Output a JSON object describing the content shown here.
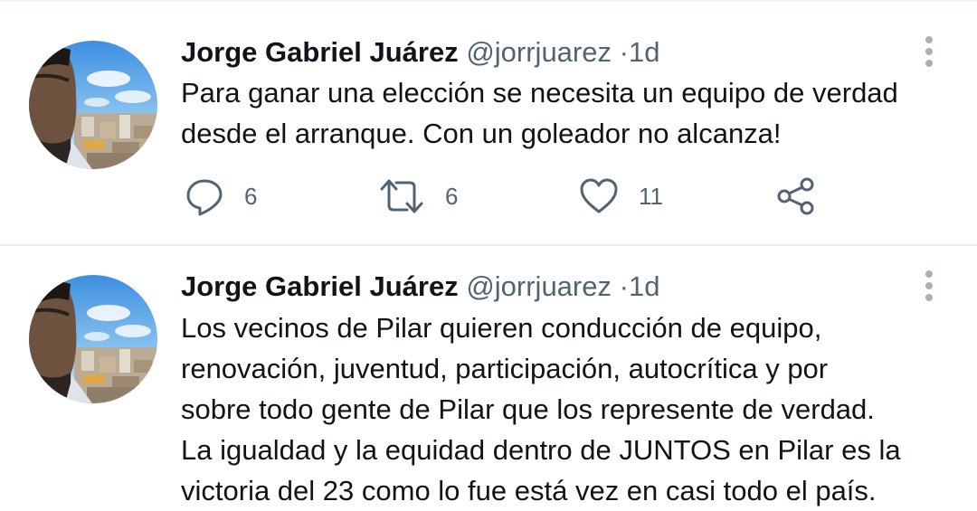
{
  "tweets": [
    {
      "author": {
        "name": "Jorge Gabriel Juárez",
        "handle": "@jorrjuarez",
        "avatar": "profile-photo"
      },
      "separator": "·",
      "time": "1d",
      "text_lines": [
        "Para ganar una elección se necesita un equipo de verdad",
        "desde el arranque. Con un goleador no alcanza!"
      ],
      "actions": {
        "reply": {
          "icon": "reply-icon",
          "count": "6"
        },
        "retweet": {
          "icon": "retweet-icon",
          "count": "6"
        },
        "like": {
          "icon": "heart-icon",
          "count": "11"
        },
        "share": {
          "icon": "share-icon"
        }
      }
    },
    {
      "author": {
        "name": "Jorge Gabriel Juárez",
        "handle": "@jorrjuarez",
        "avatar": "profile-photo"
      },
      "separator": "·",
      "time": "1d",
      "text_lines": [
        "Los vecinos de Pilar quieren conducción de equipo,",
        "renovación, juventud, participación, autocrítica y por",
        "sobre todo gente de Pilar que los represente de verdad.",
        "La igualdad y la equidad dentro de JUNTOS en Pilar es la",
        "victoria del 23 como lo fue está vez en casi todo el país."
      ]
    }
  ],
  "colors": {
    "text_primary": "#0f1419",
    "text_secondary": "#536471",
    "divider": "#e6ecf0"
  }
}
